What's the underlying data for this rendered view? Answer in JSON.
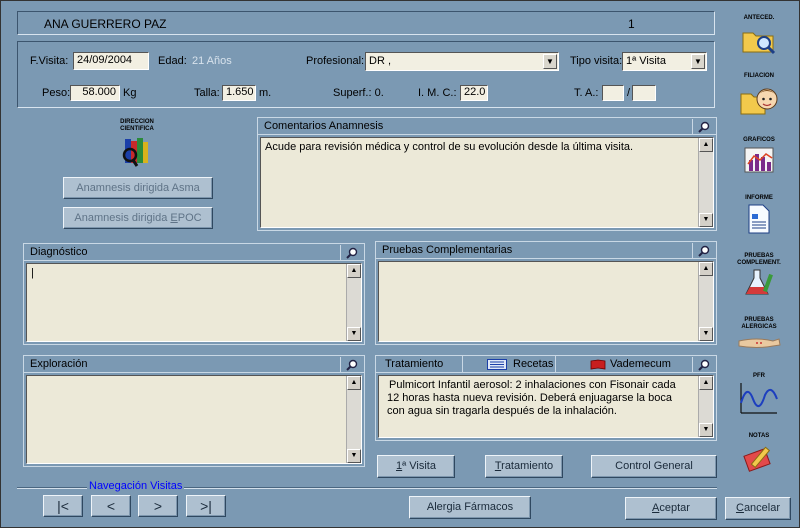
{
  "header": {
    "patient_name": "ANA GUERRERO PAZ",
    "record_number": "1"
  },
  "visit": {
    "fvisita_label": "F.Visita:",
    "fvisita_value": "24/09/2004",
    "edad_label": "Edad:",
    "edad_value": "21 Años",
    "profesional_label": "Profesional:",
    "profesional_value": "DR ,",
    "tipo_label": "Tipo visita:",
    "tipo_value": "1ª Visita",
    "peso_label": "Peso:",
    "peso_value": "58.000",
    "peso_unit": "Kg",
    "talla_label": "Talla:",
    "talla_value": "1.650",
    "talla_unit": "m.",
    "superf_label": "Superf.: 0.",
    "imc_label": "I. M. C.:",
    "imc_value": "22.0",
    "ta_label": "T. A.:",
    "ta_sep": "/"
  },
  "direccion": {
    "label_line1": "DIRECCION",
    "label_line2": "CIENTIFICA"
  },
  "buttons_left": {
    "asma": "Anamnesis dirigida Asma",
    "epoc_prefix": "Anamnesis dirigida ",
    "epoc_ul": "E",
    "epoc_suffix": "POC"
  },
  "panels": {
    "comentarios": {
      "title": "Comentarios Anamnesis",
      "text": "Acude para revisión médica y control de su evolución desde la última visita."
    },
    "diagnostico": {
      "title": "Diagnóstico",
      "text": "|"
    },
    "pruebas": {
      "title": "Pruebas Complementarias",
      "text": ""
    },
    "exploracion": {
      "title": "Exploración",
      "text": ""
    },
    "tratamiento": {
      "title": "Tratamiento",
      "tab_recetas": "Recetas",
      "tab_vademecum": "Vademecum",
      "text": "Pulmicort Infantil aerosol: 2 inhalaciones con Fisonair cada 12 horas hasta nueva revisión. Deberá enjuagarse la boca con agua sin tragarla después de la inhalación."
    }
  },
  "bottom_buttons": {
    "primera_ul": "1",
    "primera_rest": "ª Visita",
    "trat_ul": "T",
    "trat_rest": "ratamiento",
    "control": "Control General",
    "alergia": "Alergia Fármacos",
    "aceptar_ul": "A",
    "aceptar_rest": "ceptar",
    "cancelar_ul": "C",
    "cancelar_rest": "ancelar"
  },
  "navigation": {
    "title": "Navegación Visitas",
    "first": "|<",
    "prev": "<",
    "next": ">",
    "last": ">|"
  },
  "sidebar": {
    "anteced": "ANTECED.",
    "filiacion": "FILIACION",
    "graficos": "GRAFICOS",
    "informe": "INFORME",
    "pruebas_l1": "PRUEBAS",
    "pruebas_l2": "COMPLEMENT.",
    "alergicas_l1": "PRUEBAS",
    "alergicas_l2": "ALERGICAS",
    "pfr": "PFR",
    "notas": "NOTAS"
  },
  "colors": {
    "window_bg": "#7b99b3",
    "field_bg": "#f2efe2",
    "text_area_bg": "#ece9d8",
    "nav_title": "#0000ff"
  }
}
